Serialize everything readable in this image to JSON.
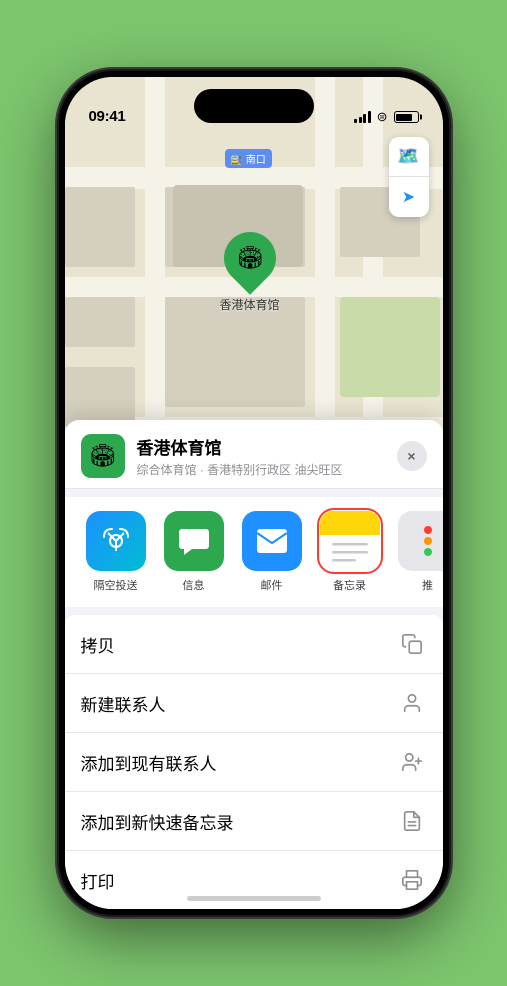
{
  "status_bar": {
    "time": "09:41",
    "location_arrow": "▲"
  },
  "map": {
    "label": "南口",
    "venue_name_on_map": "香港体育馆"
  },
  "map_controls": {
    "map_btn": "🗺",
    "location_btn": "➤"
  },
  "venue": {
    "name": "香港体育馆",
    "subtitle": "综合体育馆 · 香港特别行政区 油尖旺区",
    "icon": "🏟"
  },
  "share_items": [
    {
      "id": "airdrop",
      "label": "隔空投送",
      "selected": false
    },
    {
      "id": "messages",
      "label": "信息",
      "selected": false
    },
    {
      "id": "mail",
      "label": "邮件",
      "selected": false
    },
    {
      "id": "notes",
      "label": "备忘录",
      "selected": true
    },
    {
      "id": "more",
      "label": "推",
      "selected": false
    }
  ],
  "actions": [
    {
      "id": "copy",
      "label": "拷贝",
      "icon": "copy"
    },
    {
      "id": "new-contact",
      "label": "新建联系人",
      "icon": "person"
    },
    {
      "id": "add-contact",
      "label": "添加到现有联系人",
      "icon": "person-add"
    },
    {
      "id": "quick-note",
      "label": "添加到新快速备忘录",
      "icon": "note"
    },
    {
      "id": "print",
      "label": "打印",
      "icon": "print"
    }
  ],
  "close_label": "×"
}
